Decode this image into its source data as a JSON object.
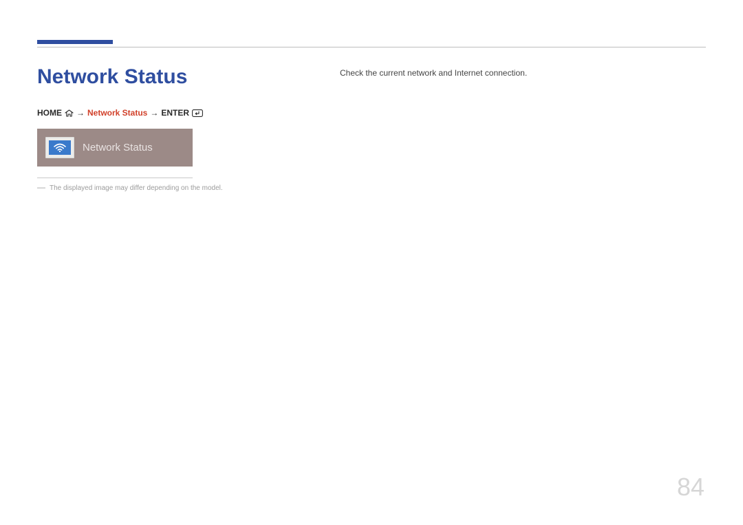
{
  "header": {
    "title": "Network Status"
  },
  "breadcrumb": {
    "home": "HOME",
    "arrow1": "→",
    "item": "Network Status",
    "arrow2": "→",
    "enter": "ENTER"
  },
  "uicard": {
    "label": "Network Status"
  },
  "disclaimer": {
    "dash": "―",
    "text": "The displayed image may differ depending on the model."
  },
  "body": {
    "description": "Check the current network and Internet connection."
  },
  "page_number": "84"
}
